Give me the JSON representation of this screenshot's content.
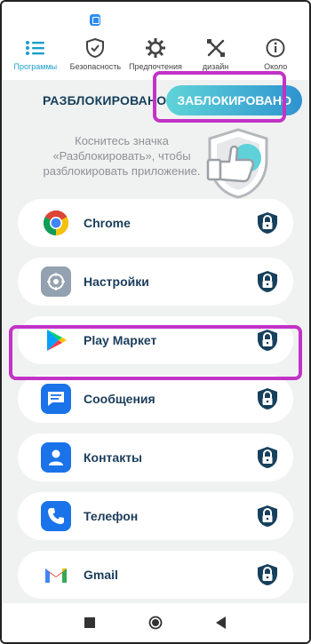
{
  "nav": {
    "items": [
      {
        "label": "Программы",
        "icon": "list-icon",
        "active": true
      },
      {
        "label": "Безопасность",
        "icon": "shield-check-icon"
      },
      {
        "label": "Предпочтения",
        "icon": "gear-icon"
      },
      {
        "label": "дизайн",
        "icon": "paint-tools-icon"
      },
      {
        "label": "Около",
        "icon": "info-icon"
      }
    ]
  },
  "tabs": {
    "unlocked": "РАЗБЛОКИРОВАНО",
    "locked": "ЗАБЛОКИРОВАНО"
  },
  "hint": "Коснитесь значка «Разблокировать», чтобы разблокировать приложение.",
  "apps": [
    {
      "name": "Chrome",
      "icon": "chrome-icon"
    },
    {
      "name": "Настройки",
      "icon": "settings-icon"
    },
    {
      "name": "Play Маркет",
      "icon": "play-market-icon"
    },
    {
      "name": "Сообщения",
      "icon": "messages-icon"
    },
    {
      "name": "Контакты",
      "icon": "contacts-icon"
    },
    {
      "name": "Телефон",
      "icon": "phone-icon"
    },
    {
      "name": "Gmail",
      "icon": "gmail-icon"
    }
  ],
  "colors": {
    "accent": "#1a9fc9",
    "highlight": "#c233c6",
    "lock": "#17405c"
  }
}
